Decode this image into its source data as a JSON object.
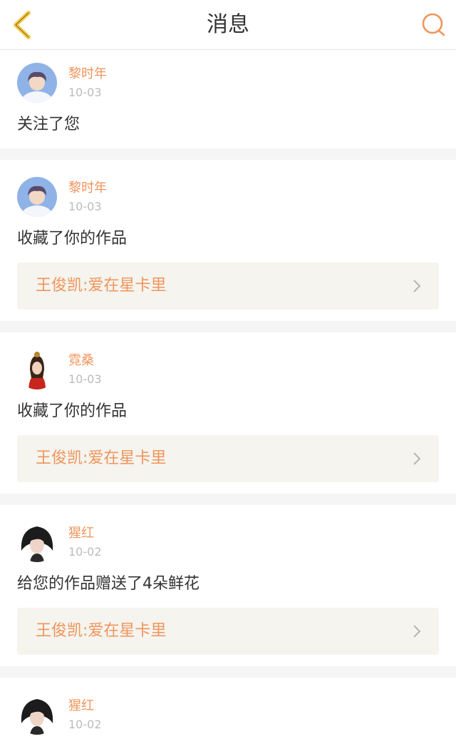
{
  "header": {
    "title": "消息",
    "back_icon": "chevron-left-icon",
    "search_icon": "search-icon"
  },
  "colors": {
    "accent": "#f0955c",
    "back": "#f6c94b",
    "text": "#333333",
    "muted": "#bbbbbb",
    "card_bg": "#f5f4ee",
    "divider": "#f5f5f5"
  },
  "messages": [
    {
      "user": "黎时年",
      "date": "10-03",
      "text": "关注了您",
      "avatar": "user-avatar-boy"
    },
    {
      "user": "黎时年",
      "date": "10-03",
      "text": "收藏了你的作品",
      "work": "王俊凯:爱在星卡里",
      "avatar": "user-avatar-boy"
    },
    {
      "user": "霓桑",
      "date": "10-03",
      "text": "收藏了你的作品",
      "work": "王俊凯:爱在星卡里",
      "avatar": "user-avatar-opera"
    },
    {
      "user": "猩红",
      "date": "10-02",
      "text": "给您的作品赠送了4朵鲜花",
      "work": "王俊凯:爱在星卡里",
      "avatar": "user-avatar-darkhair"
    },
    {
      "user": "猩红",
      "date": "10-02",
      "avatar": "user-avatar-darkhair"
    }
  ]
}
